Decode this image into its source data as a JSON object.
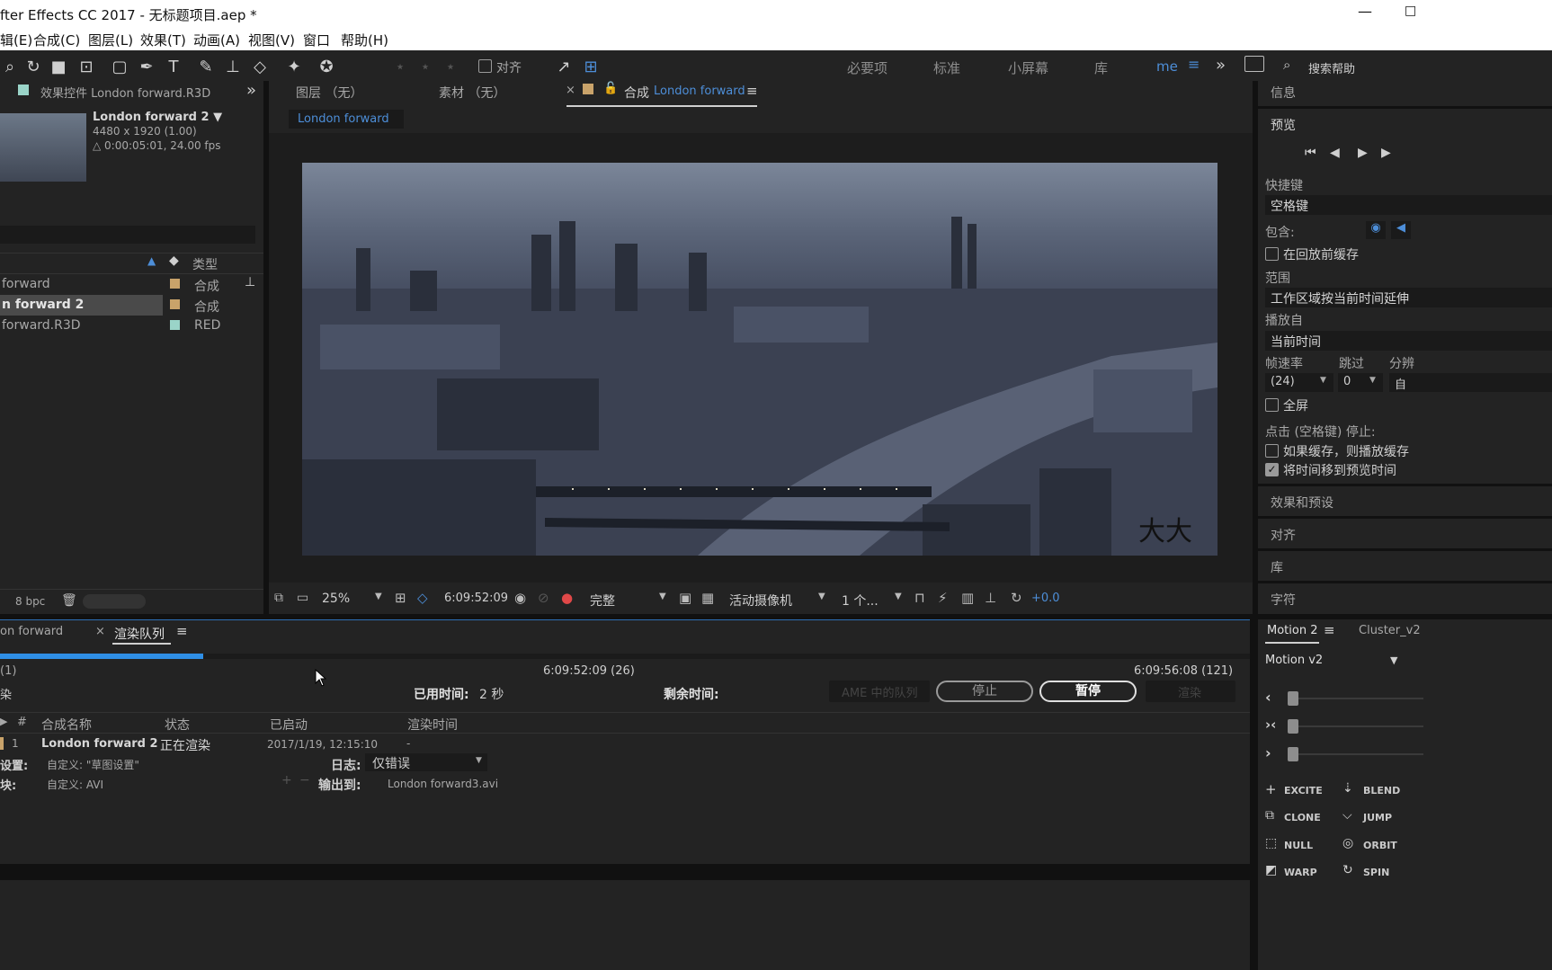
{
  "titlebar": {
    "title": "fter Effects CC 2017 - 无标题项目.aep *",
    "minimize": "—",
    "maximize": "□"
  },
  "menu": [
    "辑(E)",
    "合成(C)",
    "图层(L)",
    "效果(T)",
    "动画(A)",
    "视图(V)",
    "窗口",
    "帮助(H)"
  ],
  "toolbar": {
    "align_label": "对齐",
    "workspaces": [
      "必要项",
      "标准",
      "小屏幕",
      "库",
      "me"
    ],
    "search_placeholder": "搜索帮助",
    "more": "»"
  },
  "effects_panel": {
    "tab_label": "效果控件 London forward.R3D",
    "expand": "»"
  },
  "project": {
    "item_name": "London forward 2 ▼",
    "dimensions": "4480 x 1920 (1.00)",
    "duration": "△ 0:00:05:01, 24.00 fps",
    "type_col": "类型",
    "items": [
      {
        "name": "forward",
        "type": "合成",
        "color": "#c9a36a"
      },
      {
        "name": "n forward 2",
        "type": "合成",
        "color": "#c9a36a"
      },
      {
        "name": "forward.R3D",
        "type": "RED",
        "color": "#9ad4c8"
      }
    ],
    "bpc": "8 bpc"
  },
  "viewer": {
    "tabs": [
      "图层 （无）",
      "素材 （无）",
      "合成 London forward"
    ],
    "comp_prefix": "合成",
    "comp_name": "London forward",
    "subtab": "London forward",
    "zoom": "25%",
    "timecode": "6:09:52:09",
    "quality": "完整",
    "camera": "活动摄像机",
    "views": "1 个...",
    "exposure": "+0.0",
    "watermark": "大大"
  },
  "info_panel": {
    "info": "信息",
    "preview": "预览",
    "shortcut_label": "快捷键",
    "shortcut_value": "空格键",
    "include_label": "包含:",
    "cache_before": "在回放前缓存",
    "range_label": "范围",
    "range_value": "工作区域按当前时间延伸",
    "play_from_label": "播放自",
    "play_from_value": "当前时间",
    "fps_label": "帧速率",
    "skip_label": "跳过",
    "res_label": "分辨",
    "fps_value": "(24)",
    "skip_value": "0",
    "res_value": "自",
    "fullscreen": "全屏",
    "stop_label": "点击 (空格键) 停止:",
    "if_cached": "如果缓存，则播放缓存",
    "move_time": "将时间移到预览时间",
    "effects_presets": "效果和预设",
    "align": "对齐",
    "library": "库",
    "character": "字符"
  },
  "render": {
    "tab_prev": "on forward",
    "tab": "渲染队列",
    "count": "(1)",
    "current_time": "6:09:52:09 (26)",
    "end_time": "6:09:56:08 (121)",
    "progress": 0.14,
    "render_label": "染",
    "elapsed_label": "已用时间:",
    "elapsed_value": "2 秒",
    "remaining_label": "剩余时间:",
    "ame_btn": "AME 中的队列",
    "stop_btn": "停止",
    "pause_btn": "暂停",
    "render_btn": "渲染",
    "cols": [
      "#",
      "合成名称",
      "状态",
      "已启动",
      "渲染时间"
    ],
    "item": {
      "num": "1",
      "name": "London forward 2",
      "status": "正在渲染",
      "started": "2017/1/19, 12:15:10",
      "render_time": "-"
    },
    "settings_label": "设置:",
    "settings_value": "自定义: \"草图设置\"",
    "log_label": "日志:",
    "log_value": "仅错误",
    "module_label": "块:",
    "module_value": "自定义: AVI",
    "output_label": "输出到:",
    "output_value": "London forward3.avi"
  },
  "motion": {
    "tab": "Motion 2",
    "tab2": "Cluster_v2",
    "preset": "Motion v2",
    "sliders": [
      {
        "icon": "‹",
        "value": 0.0
      },
      {
        "icon": "›‹",
        "value": 0.0
      },
      {
        "icon": "›",
        "value": 0.0
      }
    ],
    "buttons": [
      "EXCITE",
      "BLEND",
      "CLONE",
      "JUMP",
      "NULL",
      "ORBIT",
      "WARP",
      "SPIN"
    ]
  }
}
